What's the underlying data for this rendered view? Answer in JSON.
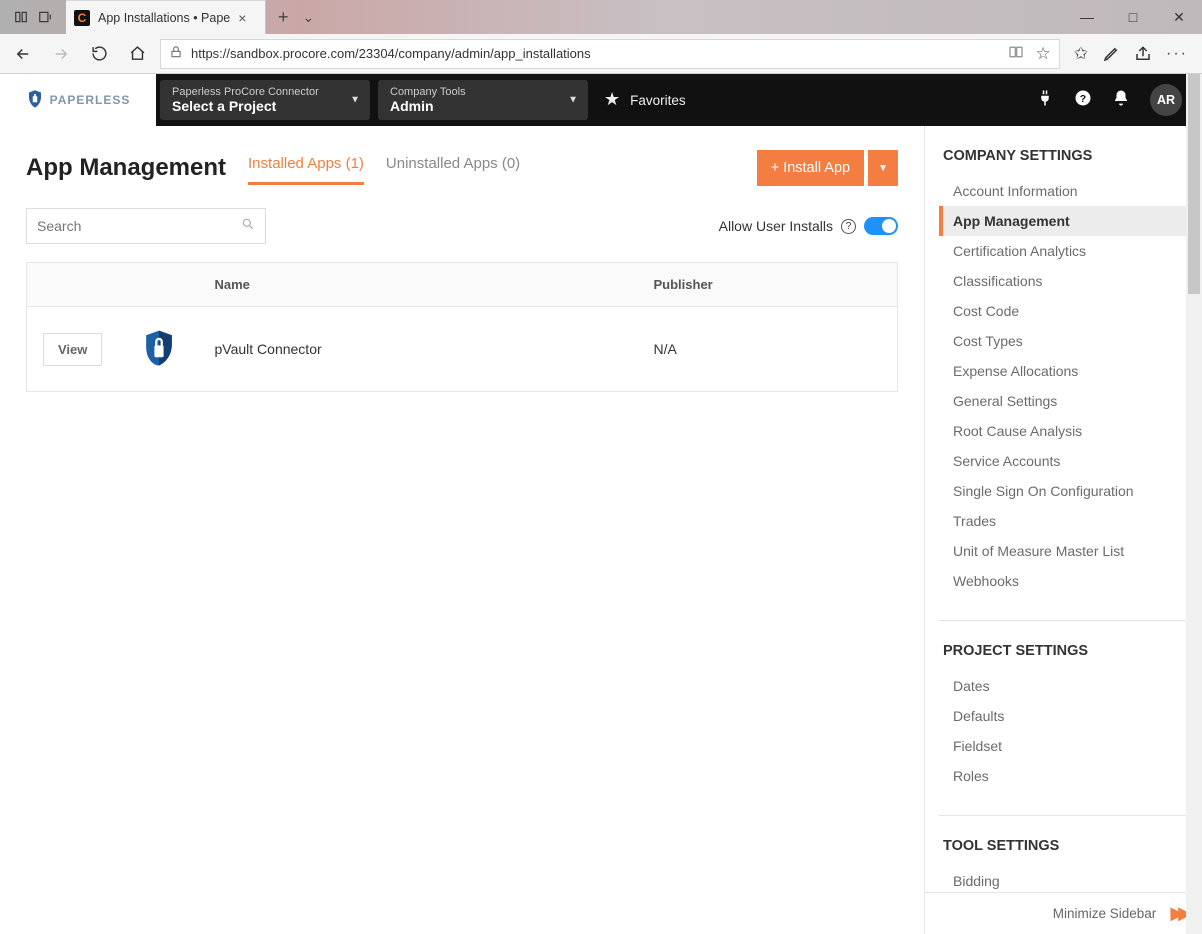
{
  "browser": {
    "tab_title": "App Installations • Pape",
    "url": "https://sandbox.procore.com/23304/company/admin/app_installations"
  },
  "topnav": {
    "brand": "PAPERLESS",
    "project_selector": {
      "label": "Paperless ProCore Connector",
      "value": "Select a Project"
    },
    "tools_selector": {
      "label": "Company Tools",
      "value": "Admin"
    },
    "favorites_label": "Favorites",
    "avatar_initials": "AR"
  },
  "page": {
    "title": "App Management",
    "tabs": {
      "installed": "Installed Apps (1)",
      "uninstalled": "Uninstalled Apps (0)"
    },
    "install_button": "+ Install App",
    "search_placeholder": "Search",
    "allow_user_installs_label": "Allow User Installs",
    "allow_user_installs_on": true
  },
  "table": {
    "headers": {
      "name": "Name",
      "publisher": "Publisher"
    },
    "view_label": "View",
    "rows": [
      {
        "name": "pVault Connector",
        "publisher": "N/A"
      }
    ]
  },
  "sidebar": {
    "company_header": "COMPANY SETTINGS",
    "company_items": [
      "Account Information",
      "App Management",
      "Certification Analytics",
      "Classifications",
      "Cost Code",
      "Cost Types",
      "Expense Allocations",
      "General Settings",
      "Root Cause Analysis",
      "Service Accounts",
      "Single Sign On Configuration",
      "Trades",
      "Unit of Measure Master List",
      "Webhooks"
    ],
    "project_header": "PROJECT SETTINGS",
    "project_items": [
      "Dates",
      "Defaults",
      "Fieldset",
      "Roles"
    ],
    "tool_header": "TOOL SETTINGS",
    "tool_items": [
      "Bidding"
    ],
    "minimize_label": "Minimize Sidebar"
  }
}
